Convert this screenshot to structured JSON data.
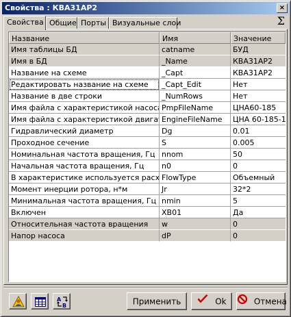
{
  "window": {
    "title": "Свойства :  КВА31АР2",
    "close_label": "×"
  },
  "tabs": [
    {
      "label": "Свойства"
    },
    {
      "label": "Общие"
    },
    {
      "label": "Порты"
    },
    {
      "label": "Визуальные слои"
    }
  ],
  "sigma_label": "Σ",
  "table": {
    "headers": [
      "Название",
      "Имя",
      "Значение"
    ],
    "rows": [
      {
        "name": "Имя таблицы БД",
        "id": "catname",
        "value": "БУД",
        "shaded": true
      },
      {
        "name": "Имя в БД",
        "id": "_Name",
        "value": "КВА31АР2",
        "shaded": true
      },
      {
        "name": "Название на схеме",
        "id": "_Capt",
        "value": "КВА31АР2",
        "shaded": false
      },
      {
        "name": "Редактировать название на схеме",
        "id": "_Capt_Edit",
        "value": "Нет",
        "shaded": false
      },
      {
        "name": "Название в две строки",
        "id": "_NumRows",
        "value": "Нет",
        "shaded": false
      },
      {
        "name": "Имя файла с характеристикой насоса",
        "id": "PmpFileName",
        "value": "ЦНА60-185",
        "shaded": false
      },
      {
        "name": "Имя файла с характеристикой двигателя",
        "id": "EngineFileName",
        "value": "ЦНА 60-185-1",
        "shaded": false
      },
      {
        "name": "Гидравлический диаметр",
        "id": "Dg",
        "value": "0.01",
        "shaded": false
      },
      {
        "name": "Проходное сечение",
        "id": "S",
        "value": "0.005",
        "shaded": false
      },
      {
        "name": "Номинальная частота вращения, Гц",
        "id": "nnom",
        "value": "50",
        "shaded": false
      },
      {
        "name": "Начальная частота вращения, Гц",
        "id": "n0",
        "value": "0",
        "shaded": false
      },
      {
        "name": "В характеристике используется расход",
        "id": "FlowType",
        "value": "Объемный",
        "shaded": false
      },
      {
        "name": "Момент инерции ротора, н*м",
        "id": "Jr",
        "value": "32*2",
        "shaded": false
      },
      {
        "name": "Минимальная частота вращения, Гц",
        "id": "nmin",
        "value": "5",
        "shaded": false
      },
      {
        "name": "Включен",
        "id": "XB01",
        "value": "Да",
        "shaded": false
      },
      {
        "name": "Относительная частота вращения",
        "id": "w",
        "value": "0",
        "shaded": true
      },
      {
        "name": "Напор насоса",
        "id": "dP",
        "value": "0",
        "shaded": true
      }
    ]
  },
  "buttons": {
    "apply": "Применить",
    "ok": "Ok",
    "cancel": "Отмена"
  },
  "icons": {
    "tool1": "user-warning-icon",
    "tool2": "table-icon",
    "tool3": "sort-ab-icon"
  },
  "colors": {
    "title_start": "#0a246a",
    "title_end": "#a6caf0",
    "ok_check": "#cc0000",
    "cancel_icon": "#cc0000"
  }
}
